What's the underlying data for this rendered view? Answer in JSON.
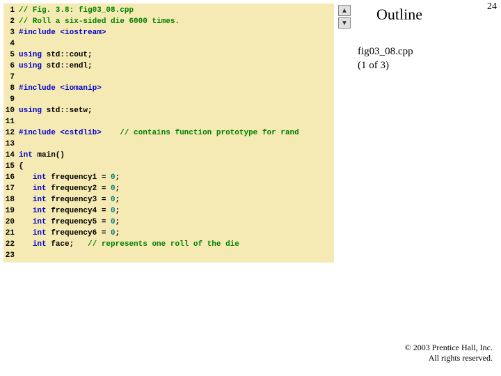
{
  "sidebar": {
    "outline": "Outline",
    "page": "24",
    "file": "fig03_08.cpp",
    "part": "(1 of 3)"
  },
  "copyright": {
    "line1": "© 2003 Prentice Hall, Inc.",
    "line2": "All rights reserved."
  },
  "code": [
    {
      "n": "1",
      "seg": [
        {
          "c": "cm",
          "t": "// Fig. 3.8: fig03_08.cpp"
        }
      ]
    },
    {
      "n": "2",
      "seg": [
        {
          "c": "cm",
          "t": "// Roll a six-sided die 6000 times."
        }
      ]
    },
    {
      "n": "3",
      "seg": [
        {
          "c": "pp",
          "t": "#include "
        },
        {
          "c": "kw",
          "t": "<iostream>"
        }
      ]
    },
    {
      "n": "4",
      "seg": []
    },
    {
      "n": "5",
      "seg": [
        {
          "c": "kw",
          "t": "using "
        },
        {
          "c": "id",
          "t": "std::cout;"
        }
      ]
    },
    {
      "n": "6",
      "seg": [
        {
          "c": "kw",
          "t": "using "
        },
        {
          "c": "id",
          "t": "std::endl;"
        }
      ]
    },
    {
      "n": "7",
      "seg": []
    },
    {
      "n": "8",
      "seg": [
        {
          "c": "pp",
          "t": "#include "
        },
        {
          "c": "kw",
          "t": "<iomanip>"
        }
      ]
    },
    {
      "n": "9",
      "seg": []
    },
    {
      "n": "10",
      "seg": [
        {
          "c": "kw",
          "t": "using "
        },
        {
          "c": "id",
          "t": "std::setw;"
        }
      ]
    },
    {
      "n": "11",
      "seg": []
    },
    {
      "n": "12",
      "seg": [
        {
          "c": "pp",
          "t": "#include "
        },
        {
          "c": "kw",
          "t": "<cstdlib>"
        },
        {
          "c": "id",
          "t": "    "
        },
        {
          "c": "cm",
          "t": "// contains function prototype for rand"
        }
      ]
    },
    {
      "n": "13",
      "seg": []
    },
    {
      "n": "14",
      "seg": [
        {
          "c": "kw",
          "t": "int "
        },
        {
          "c": "id",
          "t": "main()"
        }
      ]
    },
    {
      "n": "15",
      "seg": [
        {
          "c": "id",
          "t": "{"
        }
      ]
    },
    {
      "n": "16",
      "seg": [
        {
          "c": "id",
          "t": "   "
        },
        {
          "c": "kw",
          "t": "int "
        },
        {
          "c": "id",
          "t": "frequency1 = "
        },
        {
          "c": "num",
          "t": "0"
        },
        {
          "c": "id",
          "t": ";"
        }
      ]
    },
    {
      "n": "17",
      "seg": [
        {
          "c": "id",
          "t": "   "
        },
        {
          "c": "kw",
          "t": "int "
        },
        {
          "c": "id",
          "t": "frequency2 = "
        },
        {
          "c": "num",
          "t": "0"
        },
        {
          "c": "id",
          "t": ";"
        }
      ]
    },
    {
      "n": "18",
      "seg": [
        {
          "c": "id",
          "t": "   "
        },
        {
          "c": "kw",
          "t": "int "
        },
        {
          "c": "id",
          "t": "frequency3 = "
        },
        {
          "c": "num",
          "t": "0"
        },
        {
          "c": "id",
          "t": ";"
        }
      ]
    },
    {
      "n": "19",
      "seg": [
        {
          "c": "id",
          "t": "   "
        },
        {
          "c": "kw",
          "t": "int "
        },
        {
          "c": "id",
          "t": "frequency4 = "
        },
        {
          "c": "num",
          "t": "0"
        },
        {
          "c": "id",
          "t": ";"
        }
      ]
    },
    {
      "n": "20",
      "seg": [
        {
          "c": "id",
          "t": "   "
        },
        {
          "c": "kw",
          "t": "int "
        },
        {
          "c": "id",
          "t": "frequency5 = "
        },
        {
          "c": "num",
          "t": "0"
        },
        {
          "c": "id",
          "t": ";"
        }
      ]
    },
    {
      "n": "21",
      "seg": [
        {
          "c": "id",
          "t": "   "
        },
        {
          "c": "kw",
          "t": "int "
        },
        {
          "c": "id",
          "t": "frequency6 = "
        },
        {
          "c": "num",
          "t": "0"
        },
        {
          "c": "id",
          "t": ";"
        }
      ]
    },
    {
      "n": "22",
      "seg": [
        {
          "c": "id",
          "t": "   "
        },
        {
          "c": "kw",
          "t": "int "
        },
        {
          "c": "id",
          "t": "face;   "
        },
        {
          "c": "cm",
          "t": "// represents one roll of the die"
        }
      ]
    },
    {
      "n": "23",
      "seg": []
    }
  ]
}
